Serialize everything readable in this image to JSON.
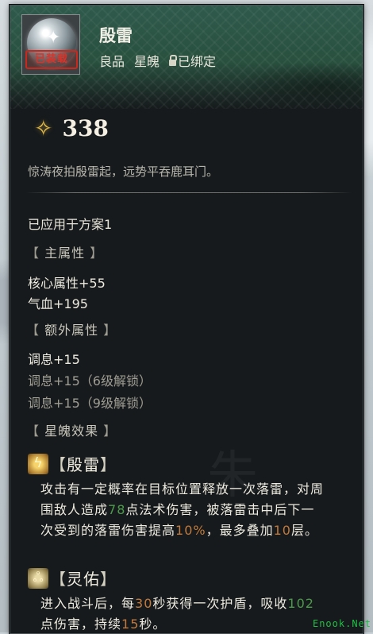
{
  "item": {
    "name": "殷雷",
    "quality": "良品",
    "type": "星魄",
    "bound_label": "已绑定",
    "stamp": "已装载",
    "icon": "star-orb-icon"
  },
  "power": {
    "icon": "star-sparkle-icon",
    "value": "338"
  },
  "flavor_text": "惊涛夜拍殷雷起，远势平吞鹿耳门。",
  "applied": "已应用于方案1",
  "main_attributes": {
    "title": "主属性",
    "lines": [
      "核心属性+55",
      "气血+195"
    ]
  },
  "extra_attributes": {
    "title": "额外属性",
    "lines": [
      "调息+15"
    ],
    "locked_lines": [
      "调息+15（6级解锁）",
      "调息+15（9级解锁）"
    ]
  },
  "effects": {
    "title": "星魄效果",
    "skills": [
      {
        "icon": "thunder-icon",
        "name": "殷雷",
        "desc_parts": [
          "攻击有一定概率在目标位置释放一次落雷，对周围敌人造成",
          "78",
          "点法术伤害，被落雷击中后下一次受到的落雷伤害提高",
          "10%",
          "，最多叠加",
          "10",
          "层。"
        ]
      },
      {
        "icon": "bless-icon",
        "name": "灵佑",
        "desc_parts": [
          "进入战斗后，每",
          "30",
          "秒获得一次护盾，吸收",
          "102",
          "点伤害，持续",
          "15",
          "秒。"
        ]
      }
    ]
  },
  "watermark": "Enook.Net",
  "colors": {
    "highlight_green": "#4c9a4b",
    "highlight_orange": "#c17a3b",
    "gold": "#e2b94a"
  }
}
